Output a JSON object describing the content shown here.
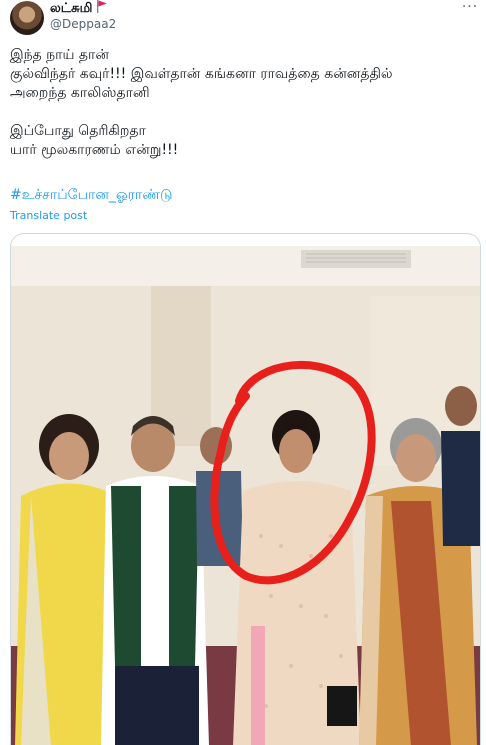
{
  "author": {
    "display_name": "லட்சுமி",
    "handle": "@Deppaa2",
    "flag_color": "#e0245e",
    "avatar": "avatar-image",
    "more_icon": "more-options-icon"
  },
  "tweet": {
    "lines": [
      "இந்த நாய் தான்",
      "குல்விந்தர் கவுர்!!! இவள்தான் கங்கனா ராவத்தை கன்னத்தில்",
      "அறைந்த காலிஸ்தானி",
      "",
      "இப்போது தெரிகிறதா",
      "யார் மூலகாரணம் என்று!!!"
    ],
    "hashtag": "#உச்சாப்போன_ஓராண்டு",
    "translate_label": "Translate post"
  },
  "media": {
    "type": "photo",
    "highlight_color": "#e8201c"
  },
  "colors": {
    "link": "#1d9bf0",
    "text": "#0f1419",
    "muted": "#536471"
  }
}
